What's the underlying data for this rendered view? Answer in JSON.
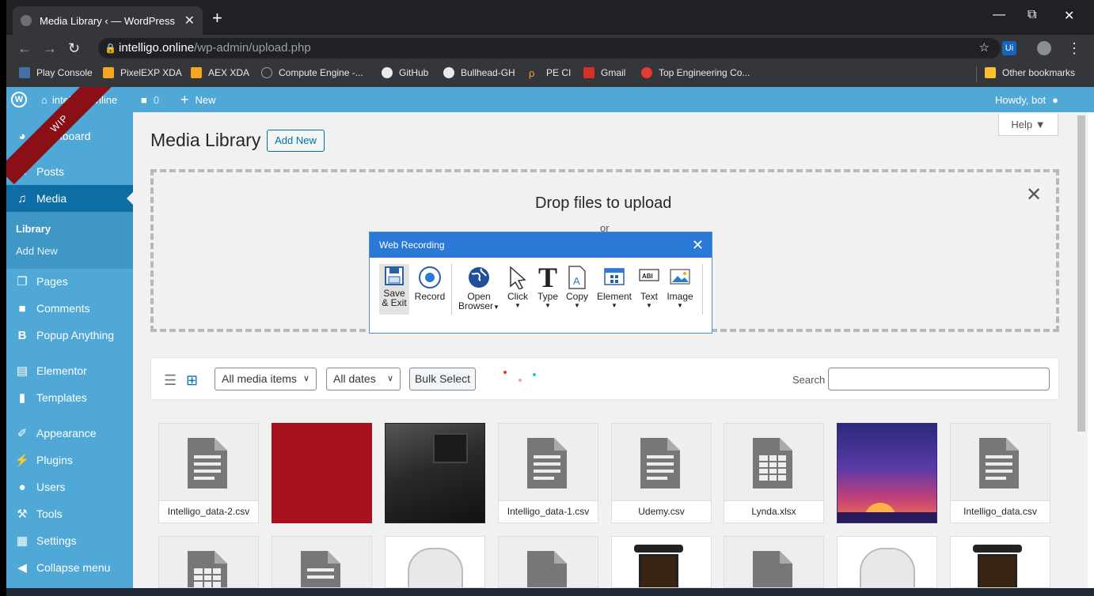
{
  "browser": {
    "tab_title": "Media Library ‹ — WordPress",
    "tab_close": "✕",
    "new_tab": "+",
    "url_host": "intelligo.online",
    "url_path": "/wp-admin/upload.php",
    "window_controls": [
      "—",
      "⧉",
      "✕"
    ],
    "bookmarks": [
      "Play Console",
      "PixelEXP XDA",
      "AEX XDA",
      "Compute Engine -...",
      "GitHub",
      "Bullhead-GH",
      "PE CI",
      "Gmail",
      "Top Engineering Co..."
    ],
    "other_bookmarks": "Other bookmarks"
  },
  "adminbar": {
    "site": "intelligo.online",
    "comments_count": "0",
    "new_label": "New",
    "howdy": "Howdy, bot"
  },
  "ribbon": "WIP",
  "sidebar": {
    "dashboard": "Dashboard",
    "posts": "Posts",
    "media": "Media",
    "library": "Library",
    "add_new": "Add New",
    "pages": "Pages",
    "comments": "Comments",
    "popup": "Popup Anything",
    "elementor": "Elementor",
    "templates": "Templates",
    "appearance": "Appearance",
    "plugins": "Plugins",
    "users": "Users",
    "tools": "Tools",
    "settings": "Settings",
    "collapse": "Collapse menu"
  },
  "main": {
    "help": "Help ▼",
    "title": "Media Library",
    "add_new": "Add New",
    "drop_title": "Drop files to upload",
    "drop_or": "or",
    "drop_close": "✕",
    "filter_type": "All media items",
    "filter_date": "All dates",
    "bulk_select": "Bulk Select",
    "search_label": "Search",
    "search_value": ""
  },
  "media_row1": [
    "Intelligo_data-2.csv",
    "",
    "",
    "Intelligo_data-1.csv",
    "Udemy.csv",
    "Lynda.xlsx",
    "",
    "Intelligo_data.csv"
  ],
  "recorder": {
    "title": "Web Recording",
    "close": "✕",
    "tools": {
      "save_exit_1": "Save",
      "save_exit_2": "& Exit",
      "record": "Record",
      "open_browser_1": "Open",
      "open_browser_2": "Browser",
      "click": "Click",
      "type": "Type",
      "copy": "Copy",
      "element": "Element",
      "text": "Text",
      "image": "Image"
    }
  },
  "colors": {
    "admin_blue": "#4fa8d6",
    "active_menu": "#0e6ea3",
    "wip_ribbon": "#8b0f17",
    "recorder_header": "#2b79d7"
  }
}
